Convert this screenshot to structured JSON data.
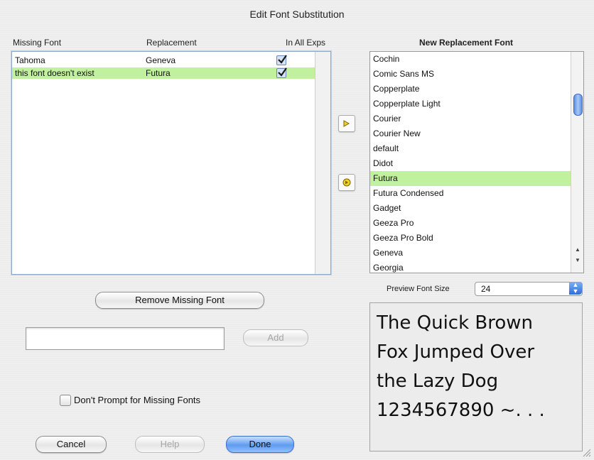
{
  "dialog": {
    "title": "Edit Font Substitution"
  },
  "table": {
    "headers": {
      "missing": "Missing Font",
      "replacement": "Replacement",
      "in_all": "In All Exps"
    },
    "rows": [
      {
        "missing": "Tahoma",
        "replacement": "Geneva",
        "in_all": true,
        "selected": false
      },
      {
        "missing": "this font doesn't exist",
        "replacement": "Futura",
        "in_all": true,
        "selected": true
      }
    ]
  },
  "arrows": {
    "move_icon": "arrow-right-icon",
    "apply_icon": "circle-arrow-icon"
  },
  "font_list": {
    "header": "New Replacement Font",
    "items": [
      "Cochin",
      "Comic Sans MS",
      "Copperplate",
      "Copperplate Light",
      "Courier",
      "Courier New",
      "default",
      "Didot",
      "Futura",
      "Futura Condensed",
      "Gadget",
      "Geeza Pro",
      "Geeza Pro Bold",
      "Geneva",
      "Georgia"
    ],
    "selected": "Futura"
  },
  "preview": {
    "size_label": "Preview Font Size",
    "size_value": "24",
    "lines": [
      "The Quick Brown",
      "Fox Jumped Over",
      "the Lazy Dog",
      "1234567890 ~. . ."
    ]
  },
  "buttons": {
    "remove": "Remove Missing Font",
    "add": "Add",
    "cancel": "Cancel",
    "help": "Help",
    "done": "Done"
  },
  "add_field": {
    "value": ""
  },
  "dont_prompt": {
    "label": "Don't Prompt for Missing Fonts",
    "checked": false
  },
  "colors": {
    "selection": "#c1f09e",
    "accent": "#5f9bf0"
  }
}
